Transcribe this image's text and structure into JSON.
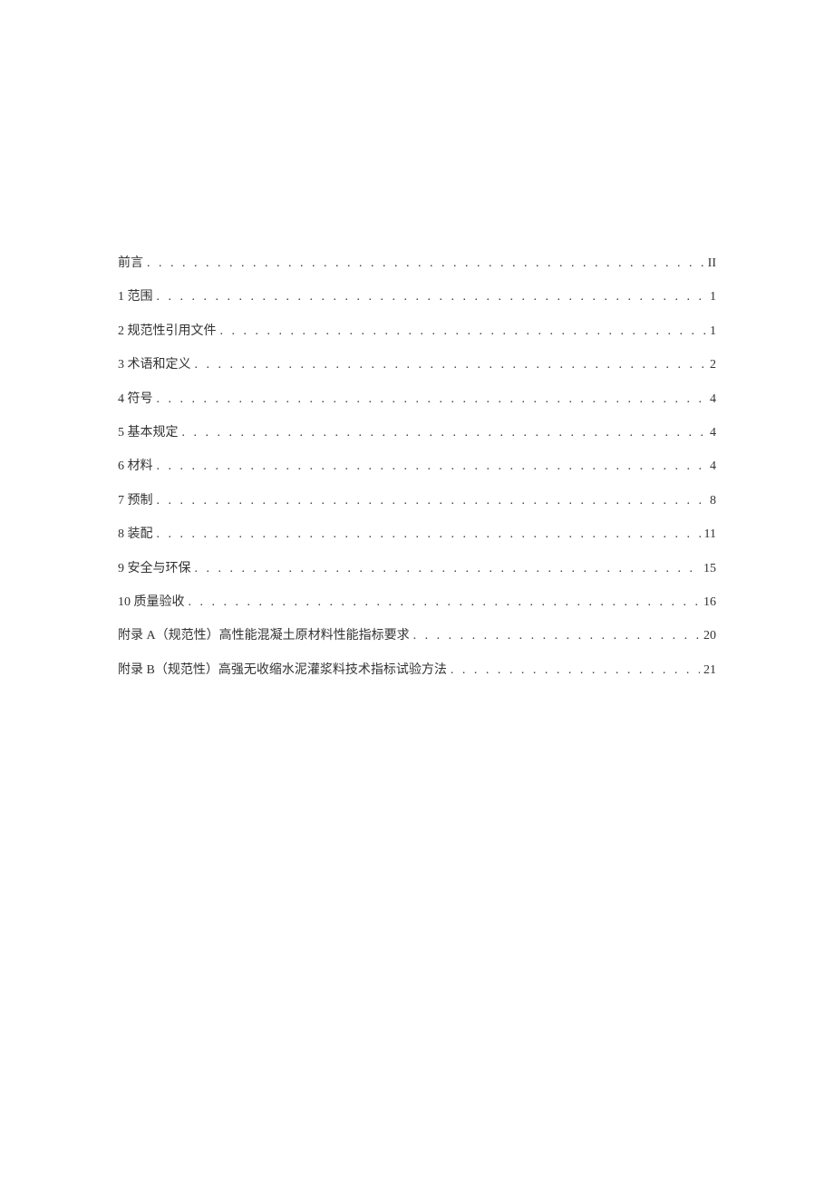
{
  "toc": {
    "entries": [
      {
        "label": "前言",
        "page": "II"
      },
      {
        "label": "1 范围",
        "page": "1"
      },
      {
        "label": "2 规范性引用文件",
        "page": "1"
      },
      {
        "label": "3 术语和定义",
        "page": "2"
      },
      {
        "label": "4 符号",
        "page": "4"
      },
      {
        "label": "5 基本规定",
        "page": "4"
      },
      {
        "label": "6 材料",
        "page": "4"
      },
      {
        "label": "7 预制",
        "page": "8"
      },
      {
        "label": "8 装配",
        "page": "11"
      },
      {
        "label": "9 安全与环保",
        "page": "15"
      },
      {
        "label": "10 质量验收",
        "page": "16"
      },
      {
        "label": "附录 A（规范性）高性能混凝土原材料性能指标要求",
        "page": "20"
      },
      {
        "label": "附录 B（规范性）高强无收缩水泥灌浆料技术指标试验方法",
        "page": "21"
      }
    ]
  }
}
